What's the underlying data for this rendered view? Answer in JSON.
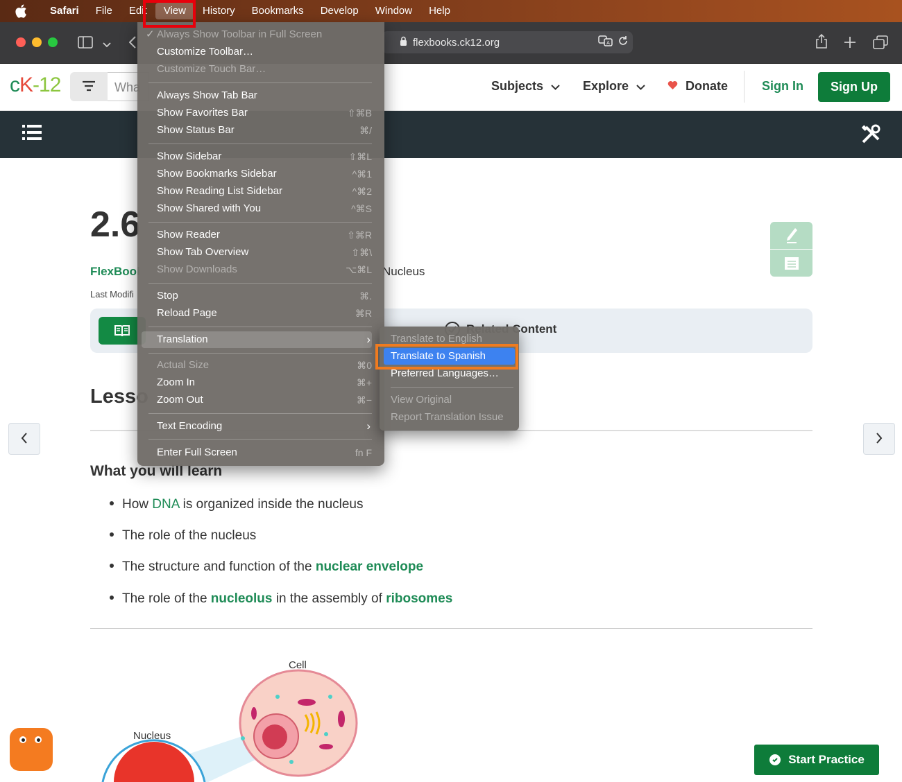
{
  "menubar": {
    "items": [
      "Safari",
      "File",
      "Edit",
      "View",
      "History",
      "Bookmarks",
      "Develop",
      "Window",
      "Help"
    ]
  },
  "browser": {
    "url": "flexbooks.ck12.org"
  },
  "site": {
    "logo": {
      "c": "c",
      "k": "K",
      "n": "-12"
    },
    "search_placeholder": "Wha",
    "nav": {
      "subjects": "Subjects",
      "explore": "Explore",
      "donate": "Donate",
      "signin": "Sign In",
      "signup": "Sign Up"
    }
  },
  "page": {
    "heading": "2.6",
    "flexbook": "FlexBool",
    "breadcrumb_tail": "Nucleus",
    "last_modified": "Last Modifi",
    "related": "Related Content",
    "lesson": "Lesso",
    "learn_heading": "What you will learn",
    "bullets": [
      {
        "pre": "How ",
        "link": "DNA",
        "post": " is organized inside the nucleus"
      },
      {
        "pre": "The role of the nucleus"
      },
      {
        "pre": "The structure and function of the ",
        "bold": "nuclear envelope"
      },
      {
        "pre": "The role of the ",
        "bold": "nucleolus",
        "mid": " in the assembly of ",
        "bold2": "ribosomes"
      }
    ],
    "cell_label": "Cell",
    "nucleus_label": "Nucleus",
    "start_practice": "Start Practice"
  },
  "view_menu": {
    "items": [
      {
        "label": "Always Show Toolbar in Full Screen",
        "shortcut": "",
        "disabled": true,
        "checked": true
      },
      {
        "label": "Customize Toolbar…",
        "shortcut": "",
        "disabled": false
      },
      {
        "label": "Customize Touch Bar…",
        "shortcut": "",
        "disabled": true
      },
      {
        "label": "Always Show Tab Bar",
        "shortcut": "",
        "disabled": false
      },
      {
        "label": "Show Favorites Bar",
        "shortcut": "⇧⌘B",
        "disabled": false
      },
      {
        "label": "Show Status Bar",
        "shortcut": "⌘/",
        "disabled": false
      },
      {
        "label": "Show Sidebar",
        "shortcut": "⇧⌘L",
        "disabled": false
      },
      {
        "label": "Show Bookmarks Sidebar",
        "shortcut": "^⌘1",
        "disabled": false
      },
      {
        "label": "Show Reading List Sidebar",
        "shortcut": "^⌘2",
        "disabled": false
      },
      {
        "label": "Show Shared with You",
        "shortcut": "^⌘S",
        "disabled": false
      },
      {
        "label": "Show Reader",
        "shortcut": "⇧⌘R",
        "disabled": false
      },
      {
        "label": "Show Tab Overview",
        "shortcut": "⇧⌘\\",
        "disabled": false
      },
      {
        "label": "Show Downloads",
        "shortcut": "⌥⌘L",
        "disabled": true
      },
      {
        "label": "Stop",
        "shortcut": "⌘.",
        "disabled": false
      },
      {
        "label": "Reload Page",
        "shortcut": "⌘R",
        "disabled": false
      },
      {
        "label": "Translation",
        "shortcut": "›",
        "disabled": false
      },
      {
        "label": "Actual Size",
        "shortcut": "⌘0",
        "disabled": true
      },
      {
        "label": "Zoom In",
        "shortcut": "⌘+",
        "disabled": false
      },
      {
        "label": "Zoom Out",
        "shortcut": "⌘−",
        "disabled": false
      },
      {
        "label": "Text Encoding",
        "shortcut": "›",
        "disabled": false
      },
      {
        "label": "Enter Full Screen",
        "shortcut": "fn F",
        "disabled": false
      }
    ]
  },
  "translation_menu": {
    "items": [
      {
        "label": "Translate to English",
        "disabled": true
      },
      {
        "label": "Translate to Spanish",
        "disabled": false
      },
      {
        "label": "Preferred Languages…",
        "disabled": false
      },
      {
        "label": "View Original",
        "disabled": true
      },
      {
        "label": "Report Translation Issue",
        "disabled": true
      }
    ]
  },
  "colors": {
    "accent": "#1e8b56",
    "highlight": "#3d82f0",
    "annotation_red": "#e8000b",
    "annotation_orange": "#f07b1f"
  }
}
